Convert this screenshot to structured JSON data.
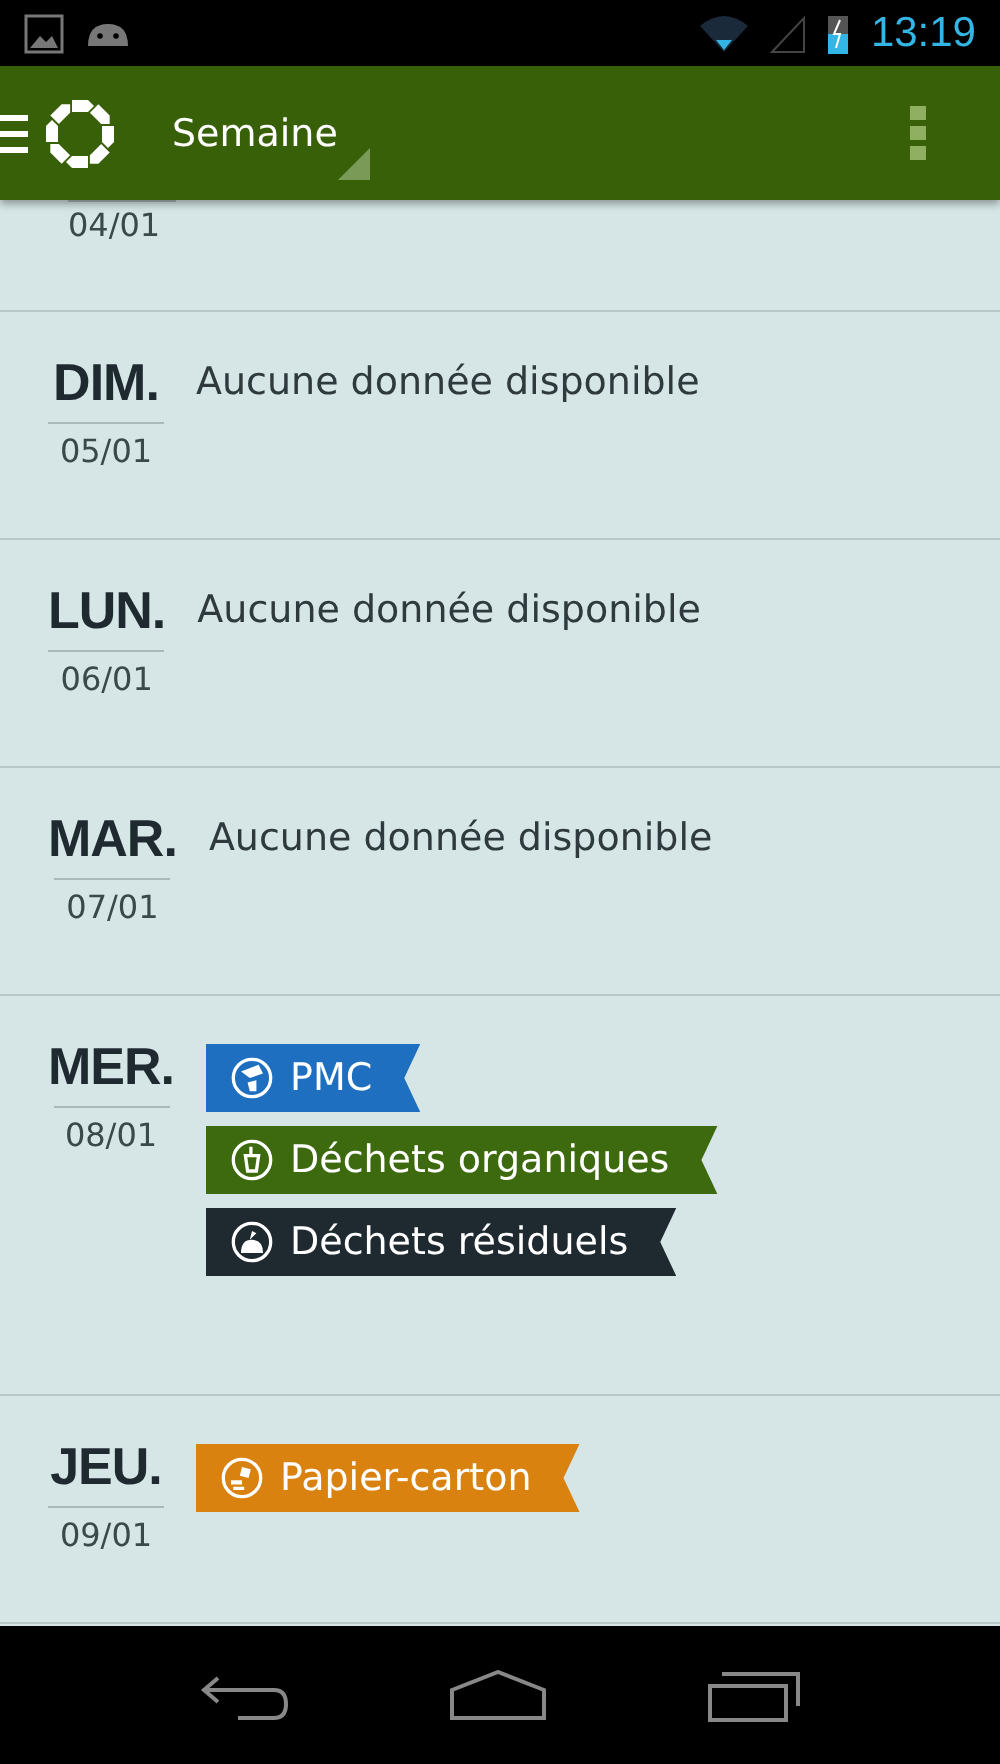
{
  "status_bar": {
    "time": "13:19"
  },
  "app_bar": {
    "title": "Semaine"
  },
  "partial_row": {
    "date": "04/01"
  },
  "days": [
    {
      "day": "DIM.",
      "date": "05/01",
      "empty_text": "Aucune donnée disponible"
    },
    {
      "day": "LUN.",
      "date": "06/01",
      "empty_text": "Aucune donnée disponible"
    },
    {
      "day": "MAR.",
      "date": "07/01",
      "empty_text": "Aucune donnée disponible"
    },
    {
      "day": "MER.",
      "date": "08/01",
      "tags": [
        {
          "label": "PMC",
          "kind": "pmc",
          "color": "#1f6fc0"
        },
        {
          "label": "Déchets organiques",
          "kind": "organic",
          "color": "#3d6a0e"
        },
        {
          "label": "Déchets résiduels",
          "kind": "residual",
          "color": "#1f2a30"
        }
      ]
    },
    {
      "day": "JEU.",
      "date": "09/01",
      "tags": [
        {
          "label": "Papier-carton",
          "kind": "paper",
          "color": "#d9820f"
        }
      ]
    }
  ]
}
